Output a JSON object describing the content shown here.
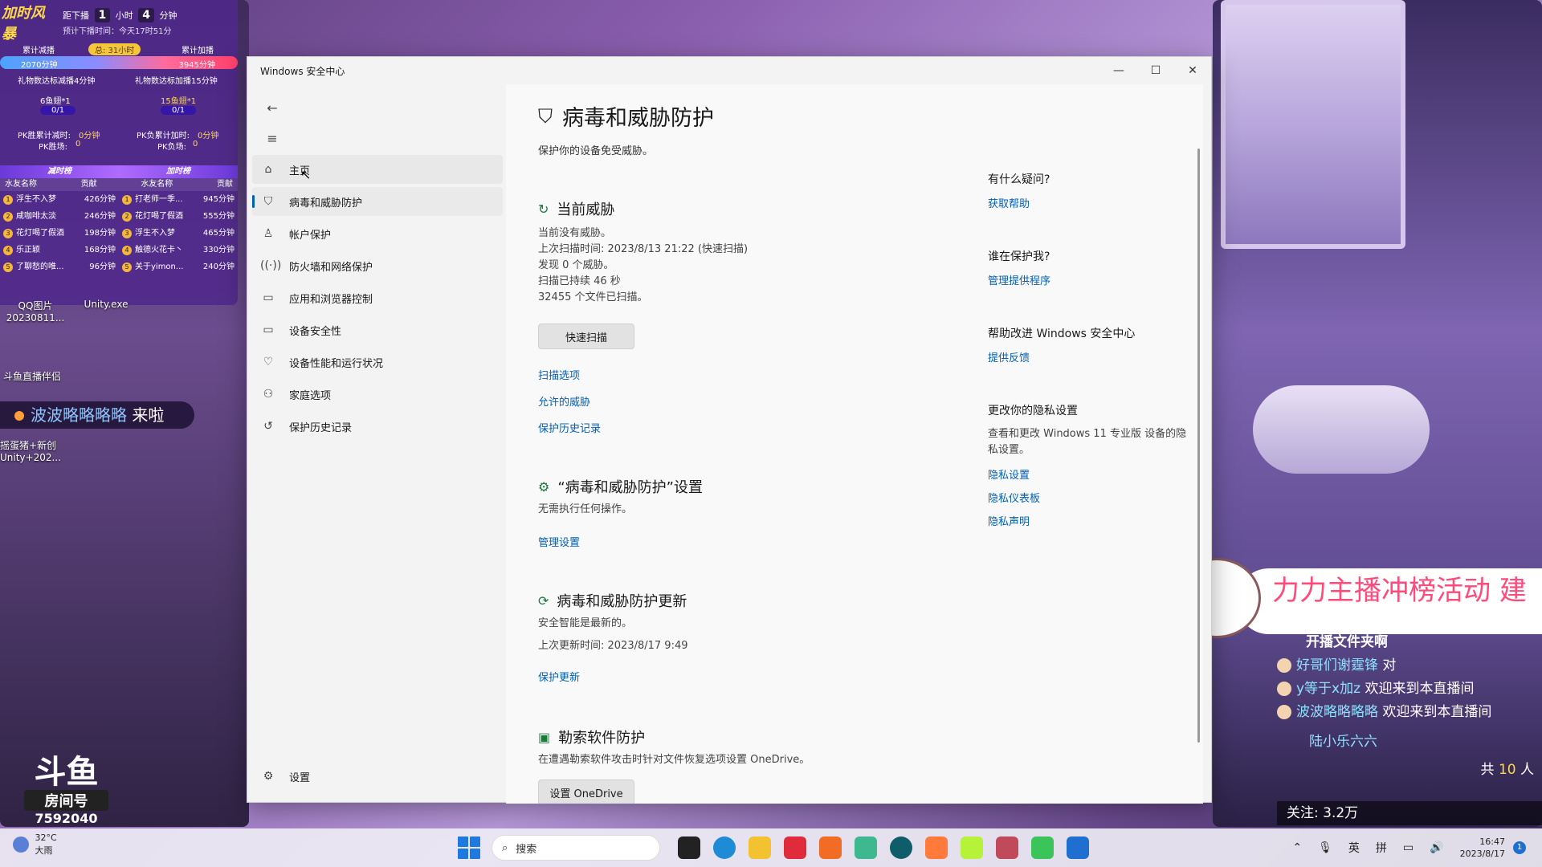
{
  "overlay": {
    "logo": "加时风暴",
    "timer_prefix": "距下播",
    "timer_hours": "1",
    "timer_hours_unit": "小时",
    "timer_minutes": "4",
    "timer_minutes_unit": "分钟",
    "planned_end": "预计下播时间：今天17时51分",
    "label_reduce": "累计减播",
    "label_total": "总: 31小时",
    "label_add": "累计加播",
    "reduce_value": "2070分钟",
    "add_value": "3945分钟",
    "left_goal": "礼物数达标减播4分钟",
    "left_gift": "6鱼翅*1",
    "left_progress": "0/1",
    "right_goal": "礼物数达标加播15分钟",
    "right_gift": "15鱼翅*1",
    "right_progress": "0/1",
    "pk_reduce": "PK胜累计减时:",
    "pk_reduce_value": "0分钟",
    "pk_add": "PK负累计加时:",
    "pk_add_value": "0分钟",
    "pk_win": "PK胜场:",
    "pk_win_value": "0",
    "pk_lose": "PK负场:",
    "pk_lose_value": "0",
    "band_left": "减时榜",
    "band_right": "加时榜",
    "col_name": "水友名称",
    "col_contrib": "贡献",
    "reduce_board": [
      {
        "rank": "1",
        "name": "浮生不入梦",
        "value": "426分钟"
      },
      {
        "rank": "2",
        "name": "咸咖啡太淡",
        "value": "246分钟"
      },
      {
        "rank": "3",
        "name": "花灯喝了假酒",
        "value": "198分钟"
      },
      {
        "rank": "4",
        "name": "乐正颖",
        "value": "168分钟"
      },
      {
        "rank": "5",
        "name": "了聊愁的唯...",
        "value": "96分钟"
      }
    ],
    "add_board": [
      {
        "rank": "1",
        "name": "打老师一季...",
        "value": "945分钟"
      },
      {
        "rank": "2",
        "name": "花灯喝了假酒",
        "value": "555分钟"
      },
      {
        "rank": "3",
        "name": "浮生不入梦",
        "value": "465分钟"
      },
      {
        "rank": "4",
        "name": "触德火花卡丶",
        "value": "330分钟"
      },
      {
        "rank": "5",
        "name": "关于yimon...",
        "value": "240分钟"
      }
    ]
  },
  "desktop": {
    "icon_qq": "QQ图片\n20230811...",
    "icon_unity": "Unity.exe",
    "icon_douyu": "斗鱼直播伴侣",
    "icon_project": "摇蛋猪+新创\nUnity+202...",
    "notice_name": "波波略略略略",
    "notice_text": " 来啦",
    "douyu_logo": "斗鱼",
    "douyu_tag": "房间号",
    "douyu_room": "7592040"
  },
  "stream": {
    "banner": "力力主播冲榜活动   建",
    "chat_top": "开播文件夹啊",
    "chat": [
      {
        "name": "好哥们谢霆锋",
        "text": " 对"
      },
      {
        "name": "y等于x加z",
        "text": " 欢迎来到本直播间"
      },
      {
        "name": "波波略略略略",
        "text": " 欢迎来到本直播间"
      }
    ],
    "vip_name": "陆小乐六六",
    "viewers_prefix": "共",
    "viewers": "10",
    "viewers_unit": "人",
    "follow": "关注: 3.2万"
  },
  "window": {
    "title": "Windows 安全中心",
    "minimize": "—",
    "maximize": "☐",
    "close": "✕"
  },
  "nav": {
    "items": [
      {
        "label": "主页",
        "icon": "home-icon"
      },
      {
        "label": "病毒和威胁防护",
        "icon": "shield-icon"
      },
      {
        "label": "帐户保护",
        "icon": "person-icon"
      },
      {
        "label": "防火墙和网络保护",
        "icon": "wifi-icon"
      },
      {
        "label": "应用和浏览器控制",
        "icon": "app-window-icon"
      },
      {
        "label": "设备安全性",
        "icon": "laptop-icon"
      },
      {
        "label": "设备性能和运行状况",
        "icon": "heart-icon"
      },
      {
        "label": "家庭选项",
        "icon": "family-icon"
      },
      {
        "label": "保护历史记录",
        "icon": "history-icon"
      }
    ],
    "settings": "设置"
  },
  "main": {
    "title": "病毒和威胁防护",
    "subtitle": "保护你的设备免受威胁。",
    "current": {
      "title": "当前威胁",
      "line1": "当前没有威胁。",
      "line2": "上次扫描时间: 2023/8/13 21:22 (快速扫描)",
      "line3": "发现 0 个威胁。",
      "line4": "扫描已持续 46 秒",
      "line5": "32455 个文件已扫描。",
      "quick_scan": "快速扫描",
      "scan_options": "扫描选项",
      "allowed": "允许的威胁",
      "history": "保护历史记录"
    },
    "settings": {
      "title": "“病毒和威胁防护”设置",
      "desc": "无需执行任何操作。",
      "manage": "管理设置"
    },
    "updates": {
      "title": "病毒和威胁防护更新",
      "desc": "安全智能是最新的。",
      "last": "上次更新时间: 2023/8/17 9:49",
      "link": "保护更新"
    },
    "ransom": {
      "title": "勒索软件防护",
      "desc": "在遭遇勒索软件攻击时针对文件恢复选项设置 OneDrive。",
      "button": "设置 OneDrive"
    }
  },
  "side": {
    "q1": "有什么疑问?",
    "a1": "获取帮助",
    "q2": "谁在保护我?",
    "a2": "管理提供程序",
    "q3": "帮助改进 Windows 安全中心",
    "a3": "提供反馈",
    "q4": "更改你的隐私设置",
    "d4": "查看和更改 Windows 11 专业版 设备的隐私设置。",
    "a4a": "隐私设置",
    "a4b": "隐私仪表板",
    "a4c": "隐私声明"
  },
  "taskbar": {
    "temp": "32°C",
    "weather": "大雨",
    "search": "搜索",
    "tray_lang1": "英",
    "tray_lang2": "拼",
    "time": "16:47",
    "date": "2023/8/17",
    "badge": "1"
  }
}
